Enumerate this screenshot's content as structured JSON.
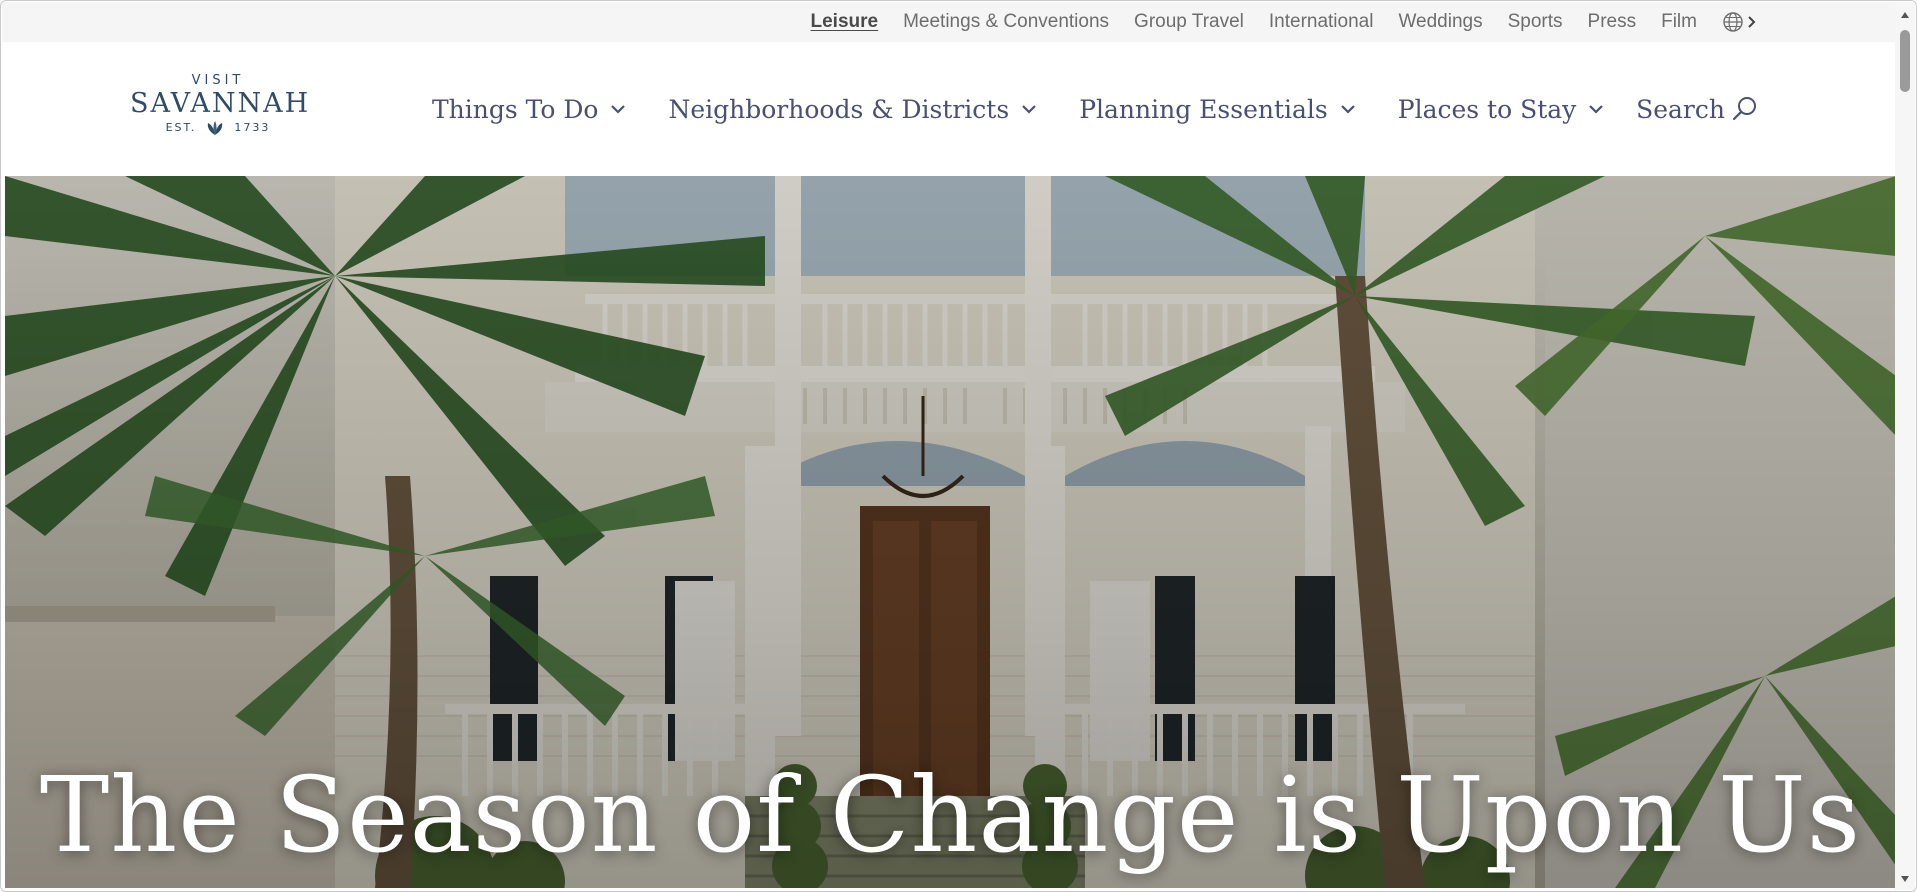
{
  "utility_nav": {
    "items": [
      {
        "label": "Leisure",
        "active": true
      },
      {
        "label": "Meetings & Conventions"
      },
      {
        "label": "Group Travel"
      },
      {
        "label": "International"
      },
      {
        "label": "Weddings"
      },
      {
        "label": "Sports"
      },
      {
        "label": "Press"
      },
      {
        "label": "Film"
      }
    ],
    "language_icon": "globe-icon",
    "language_arrow": "chevron-right-icon"
  },
  "logo": {
    "visit": "VISIT",
    "name": "SAVANNAH",
    "est": "EST.",
    "year": "1733",
    "mark_icon": "leaf-icon"
  },
  "main_nav": {
    "items": [
      {
        "label": "Things To Do",
        "icon": "chevron-down-icon"
      },
      {
        "label": "Neighborhoods & Districts",
        "icon": "chevron-down-icon"
      },
      {
        "label": "Planning Essentials",
        "icon": "chevron-down-icon"
      },
      {
        "label": "Places to Stay",
        "icon": "chevron-down-icon"
      }
    ],
    "search_label": "Search",
    "search_icon": "search-icon"
  },
  "hero": {
    "title": "The Season of Change is Upon Us"
  },
  "colors": {
    "nav_text": "#4a4f74",
    "logo": "#2f4b66",
    "utility_bg": "#f5f5f5",
    "utility_text": "#6d6d6d"
  }
}
